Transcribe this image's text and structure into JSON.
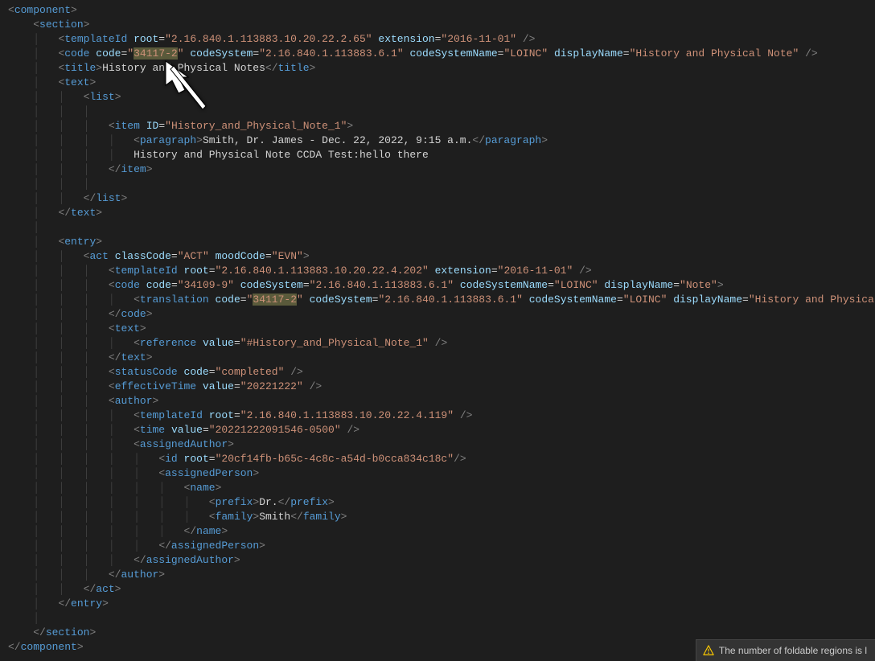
{
  "warning_text": "The number of foldable regions is l",
  "xml": {
    "component": "component",
    "section": "section",
    "templateId": "templateId",
    "root": "root",
    "extension": "extension",
    "code": "code",
    "codeAttr": "code",
    "codeSystem": "codeSystem",
    "codeSystemName": "codeSystemName",
    "displayName": "displayName",
    "title": "title",
    "text": "text",
    "list": "list",
    "item": "item",
    "ID": "ID",
    "paragraph": "paragraph",
    "entry": "entry",
    "act": "act",
    "classCode": "classCode",
    "moodCode": "moodCode",
    "translation": "translation",
    "reference": "reference",
    "value": "value",
    "statusCode": "statusCode",
    "effectiveTime": "effectiveTime",
    "author": "author",
    "time": "time",
    "assignedAuthor": "assignedAuthor",
    "id": "id",
    "assignedPerson": "assignedPerson",
    "name": "name",
    "prefix": "prefix",
    "family": "family"
  },
  "vals": {
    "sec_tmpl_root": "2.16.840.1.113883.10.20.22.2.65",
    "sec_tmpl_ext": "2016-11-01",
    "sec_code_code": "34117-2",
    "sec_code_cs": "2.16.840.1.113883.6.1",
    "sec_code_csn": "LOINC",
    "sec_code_dn": "History and Physical Note",
    "title_text": "History and Physical Notes",
    "item_id": "History_and_Physical_Note_1",
    "para_text": "Smith, Dr. James - Dec. 22, 2022, 9:15 a.m.",
    "item_text2": "History and Physical Note CCDA Test:hello there",
    "act_classCode": "ACT",
    "act_moodCode": "EVN",
    "act_tmpl_root": "2.16.840.1.113883.10.20.22.4.202",
    "act_tmpl_ext": "2016-11-01",
    "act_code_code": "34109-9",
    "act_code_cs": "2.16.840.1.113883.6.1",
    "act_code_csn": "LOINC",
    "act_code_dn": "Note",
    "trans_code": "34117-2",
    "trans_cs": "2.16.840.1.113883.6.1",
    "trans_csn": "LOINC",
    "trans_dn": "History and Physical Note",
    "ref_value": "#History_and_Physical_Note_1",
    "status_code": "completed",
    "eff_value": "20221222",
    "auth_tmpl_root": "2.16.840.1.113883.10.20.22.4.119",
    "time_value": "20221222091546-0500",
    "id_root": "20cf14fb-b65c-4c8c-a54d-b0cca834c18c",
    "prefix_text": "Dr.",
    "family_text": "Smith"
  }
}
